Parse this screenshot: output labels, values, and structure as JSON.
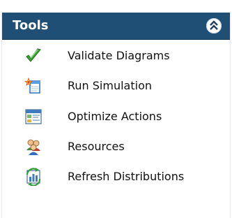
{
  "panel": {
    "title": "Tools",
    "collapse_icon": "double-chevron-up-icon",
    "header_color": "#1f4f74"
  },
  "items": [
    {
      "label": "Validate Diagrams",
      "icon": "green-checkmark-icon"
    },
    {
      "label": "Run Simulation",
      "icon": "document-sparkle-icon"
    },
    {
      "label": "Optimize Actions",
      "icon": "window-list-icon"
    },
    {
      "label": "Resources",
      "icon": "people-group-icon"
    },
    {
      "label": "Refresh Distributions",
      "icon": "chart-refresh-icon"
    }
  ]
}
